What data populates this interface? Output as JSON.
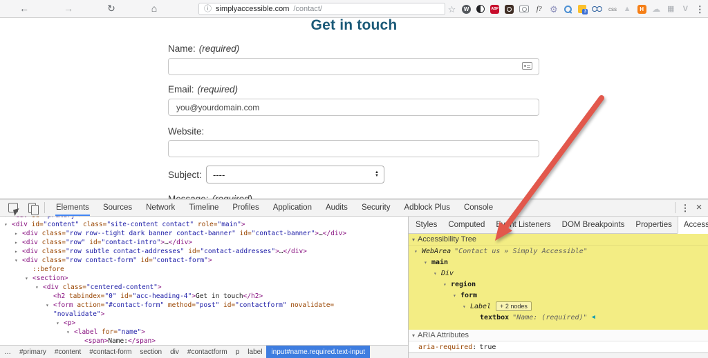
{
  "colors": {
    "heading_teal": "#1b5a78",
    "highlight_yellow": "#f3ed84",
    "arrow_red": "#e2584c",
    "tab_accent": "#4285f4",
    "crumb_blue": "#3e7de0",
    "code_tag": "#881280",
    "code_attr": "#994500",
    "code_value": "#1a1aa6"
  },
  "browser": {
    "nav": [
      {
        "name": "back-button",
        "glyph": "←",
        "color": "#5f6368"
      },
      {
        "name": "forward-button",
        "glyph": "→",
        "color": "#a8abad"
      },
      {
        "name": "reload-button",
        "glyph": "↻",
        "color": "#5f6368"
      },
      {
        "name": "home-button",
        "glyph": "⌂",
        "color": "#5f6368"
      }
    ],
    "url": {
      "info_icon": "ⓘ",
      "domain": "simplyaccessible.com",
      "path": "/contact/"
    },
    "extensions": [
      {
        "name": "bookmark-star",
        "kind": "glyph",
        "glyph": "☆",
        "color": "#9aa0a6",
        "fs": 13
      },
      {
        "name": "wordpress-extension",
        "kind": "badge",
        "text": "W",
        "bg": "#54585d",
        "shape": "circle",
        "fs": 8
      },
      {
        "name": "contrast-extension",
        "kind": "contrast"
      },
      {
        "name": "adblock-plus-extension",
        "kind": "badge",
        "text": "ABP",
        "bg": "#c70d2c",
        "shape": "round",
        "fs": 5
      },
      {
        "name": "screenshot-lens-extension",
        "kind": "lens"
      },
      {
        "name": "camera-extension",
        "kind": "camera"
      },
      {
        "name": "font-finder-extension",
        "kind": "glyph",
        "glyph": "f?",
        "color": "#3a3a3a",
        "fs": 10,
        "italic": true
      },
      {
        "name": "settings-gear-extension",
        "kind": "glyph",
        "glyph": "⚙",
        "color": "#8d90bb",
        "fs": 13
      },
      {
        "name": "magnifier-extension",
        "kind": "magnifier"
      },
      {
        "name": "calendar-extension",
        "kind": "calendar",
        "badge": "3"
      },
      {
        "name": "goggles-extension",
        "kind": "goggles"
      },
      {
        "name": "css-toggle-extension",
        "kind": "glyph",
        "glyph": "css",
        "color": "#77797c",
        "fs": 8
      },
      {
        "name": "triangle-extension",
        "kind": "glyph",
        "glyph": "▲",
        "color": "#c3c6ca",
        "fs": 11
      },
      {
        "name": "h-badge-extension",
        "kind": "badge",
        "text": "H",
        "bg": "#f57f17",
        "shape": "round",
        "fs": 8
      },
      {
        "name": "cloud-extension",
        "kind": "glyph",
        "glyph": "☁",
        "color": "#c3c6ca",
        "fs": 12
      },
      {
        "name": "pixel-grid-extension",
        "kind": "glyph",
        "glyph": "▦",
        "color": "#a9adb2",
        "fs": 11
      },
      {
        "name": "v-extension",
        "kind": "glyph",
        "glyph": "V",
        "color": "#b6b9bd",
        "fs": 11,
        "bold": true
      },
      {
        "name": "browser-menu",
        "kind": "glyph",
        "glyph": "⋮",
        "color": "#5f6368",
        "fs": 13,
        "bold": true
      }
    ]
  },
  "page": {
    "heading": "Get in touch",
    "form": {
      "name": {
        "label": "Name:",
        "required": "(required)",
        "value": ""
      },
      "email": {
        "label": "Email:",
        "required": "(required)",
        "value": "you@yourdomain.com"
      },
      "website": {
        "label": "Website:",
        "value": ""
      },
      "subject": {
        "label": "Subject:",
        "value": "----"
      },
      "message": {
        "label": "Message:",
        "required": "(required)"
      }
    }
  },
  "devtools": {
    "toolbar_tabs": [
      {
        "label": "Elements",
        "selected": true
      },
      {
        "label": "Sources"
      },
      {
        "label": "Network"
      },
      {
        "label": "Timeline"
      },
      {
        "label": "Profiles"
      },
      {
        "label": "Application"
      },
      {
        "label": "Audits"
      },
      {
        "label": "Security"
      },
      {
        "label": "Adblock Plus"
      },
      {
        "label": "Console"
      }
    ],
    "elements_tree": {
      "rows": [
        {
          "ind": 0,
          "tri": "open",
          "segs": [
            [
              "t",
              "<div"
            ],
            [
              "a",
              " id="
            ],
            [
              "v",
              "\"primary\""
            ],
            [
              "t",
              ">"
            ]
          ]
        },
        {
          "ind": 0,
          "tri": "open",
          "segs": [
            [
              "t",
              "<div"
            ],
            [
              "a",
              " id="
            ],
            [
              "v",
              "\"content\""
            ],
            [
              "a",
              " class="
            ],
            [
              "v",
              "\"site-content contact\""
            ],
            [
              "a",
              " role="
            ],
            [
              "v",
              "\"main\""
            ],
            [
              "t",
              ">"
            ]
          ]
        },
        {
          "ind": 1,
          "tri": "closed",
          "segs": [
            [
              "t",
              "<div"
            ],
            [
              "a",
              " class="
            ],
            [
              "v",
              "\"row row--tight dark banner contact-banner\""
            ],
            [
              "a",
              " id="
            ],
            [
              "v",
              "\"contact-banner\""
            ],
            [
              "t",
              ">"
            ],
            [
              "p",
              "…"
            ],
            [
              "t",
              "</div>"
            ]
          ]
        },
        {
          "ind": 1,
          "tri": "closed",
          "segs": [
            [
              "t",
              "<div"
            ],
            [
              "a",
              " class="
            ],
            [
              "v",
              "\"row\""
            ],
            [
              "a",
              " id="
            ],
            [
              "v",
              "\"contact-intro\""
            ],
            [
              "t",
              ">"
            ],
            [
              "p",
              "…"
            ],
            [
              "t",
              "</div>"
            ]
          ]
        },
        {
          "ind": 1,
          "tri": "closed",
          "segs": [
            [
              "t",
              "<div"
            ],
            [
              "a",
              " class="
            ],
            [
              "v",
              "\"row subtle contact-addresses\""
            ],
            [
              "a",
              " id="
            ],
            [
              "v",
              "\"contact-addresses\""
            ],
            [
              "t",
              ">"
            ],
            [
              "p",
              "…"
            ],
            [
              "t",
              "</div>"
            ]
          ]
        },
        {
          "ind": 1,
          "tri": "open",
          "segs": [
            [
              "t",
              "<div"
            ],
            [
              "a",
              " class="
            ],
            [
              "v",
              "\"row contact-form\""
            ],
            [
              "a",
              " id="
            ],
            [
              "v",
              "\"contact-form\""
            ],
            [
              "t",
              ">"
            ]
          ]
        },
        {
          "ind": 2,
          "tri": null,
          "segs": [
            [
              "s",
              "::before"
            ]
          ]
        },
        {
          "ind": 2,
          "tri": "open",
          "segs": [
            [
              "t",
              "<section>"
            ]
          ]
        },
        {
          "ind": 3,
          "tri": "open",
          "segs": [
            [
              "t",
              "<div"
            ],
            [
              "a",
              " class="
            ],
            [
              "v",
              "\"centered-content\""
            ],
            [
              "t",
              ">"
            ]
          ]
        },
        {
          "ind": 4,
          "tri": null,
          "segs": [
            [
              "t",
              "<h2"
            ],
            [
              "a",
              " tabindex="
            ],
            [
              "v",
              "\"0\""
            ],
            [
              "a",
              " id="
            ],
            [
              "v",
              "\"acc-heading-4\""
            ],
            [
              "t",
              ">"
            ],
            [
              "p",
              "Get in touch"
            ],
            [
              "t",
              "</h2>"
            ]
          ]
        },
        {
          "ind": 4,
          "tri": "open",
          "segs": [
            [
              "t",
              "<form"
            ],
            [
              "a",
              " action="
            ],
            [
              "v",
              "\"#contact-form\""
            ],
            [
              "a",
              " method="
            ],
            [
              "v",
              "\"post\""
            ],
            [
              "a",
              " id="
            ],
            [
              "v",
              "\"contactform\""
            ],
            [
              "a",
              " novalidate="
            ]
          ]
        },
        {
          "ind": 4,
          "tri": null,
          "segs": [
            [
              "v",
              "\"novalidate\""
            ],
            [
              "t",
              ">"
            ]
          ]
        },
        {
          "ind": 5,
          "tri": "open",
          "segs": [
            [
              "t",
              "<p>"
            ]
          ]
        },
        {
          "ind": 6,
          "tri": "open",
          "segs": [
            [
              "t",
              "<label"
            ],
            [
              "a",
              " for="
            ],
            [
              "v",
              "\"name\""
            ],
            [
              "t",
              ">"
            ]
          ]
        },
        {
          "ind": 7,
          "tri": null,
          "segs": [
            [
              "t",
              "<span>"
            ],
            [
              "p",
              "Name:"
            ],
            [
              "t",
              "</span>"
            ]
          ]
        }
      ]
    },
    "breadcrumbs": {
      "items": [
        "…",
        "#primary",
        "#content",
        "#contact-form",
        "section",
        "div",
        "#contactform",
        "p",
        "label"
      ],
      "selected": "input#name.required.text-input"
    },
    "sidebar": {
      "tabs": [
        {
          "label": "Styles"
        },
        {
          "label": "Computed"
        },
        {
          "label": "Event Listeners"
        },
        {
          "label": "DOM Breakpoints"
        },
        {
          "label": "Properties"
        },
        {
          "label": "Accessibility",
          "selected": true
        }
      ],
      "accessibility": {
        "section_title": "Accessibility Tree",
        "tree": [
          {
            "ind": 0,
            "tri": true,
            "role": "WebArea",
            "italic": true,
            "name": "\"Contact us » Simply Accessible\""
          },
          {
            "ind": 1,
            "tri": true,
            "role": "main",
            "bold": true
          },
          {
            "ind": 2,
            "tri": true,
            "role": "Div",
            "italic": true
          },
          {
            "ind": 3,
            "tri": true,
            "role": "region",
            "bold": true
          },
          {
            "ind": 4,
            "tri": true,
            "role": "form",
            "bold": true
          },
          {
            "ind": 5,
            "tri": true,
            "role": "Label",
            "italic": true,
            "chip": "+ 2 nodes"
          },
          {
            "ind": 6,
            "tri": false,
            "role": "textbox",
            "bold": true,
            "name": "\"Name: (required)\"",
            "marker": true
          }
        ],
        "aria_section_title": "ARIA Attributes",
        "aria_attributes": [
          {
            "name": "aria-required",
            "value": "true"
          }
        ]
      }
    }
  }
}
